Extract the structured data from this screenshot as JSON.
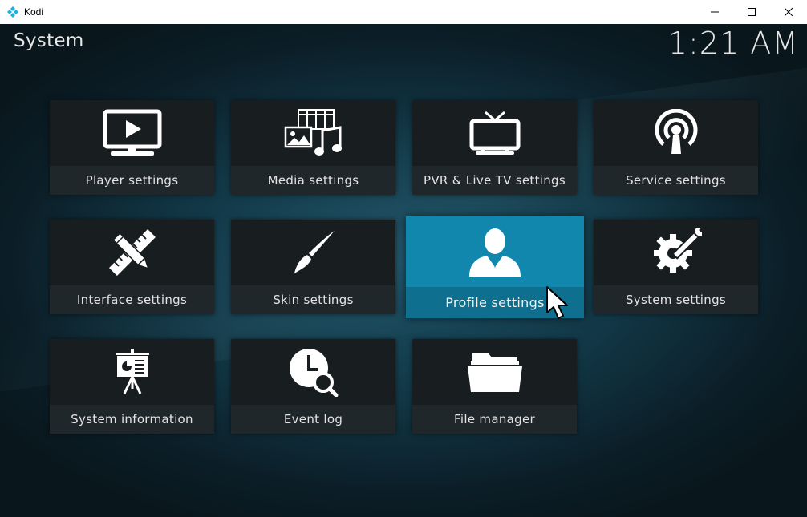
{
  "window": {
    "title": "Kodi",
    "controls": [
      "minimize",
      "maximize",
      "close"
    ]
  },
  "header": {
    "title": "System",
    "clock": "1:21 AM"
  },
  "tiles": [
    {
      "label": "Player settings",
      "icon": "play-screen-icon"
    },
    {
      "label": "Media settings",
      "icon": "media-icon"
    },
    {
      "label": "PVR & Live TV settings",
      "icon": "tv-icon"
    },
    {
      "label": "Service settings",
      "icon": "broadcast-icon"
    },
    {
      "label": "Interface settings",
      "icon": "pencil-ruler-icon"
    },
    {
      "label": "Skin settings",
      "icon": "paintbrush-icon"
    },
    {
      "label": "Profile settings",
      "icon": "user-icon",
      "focused": true
    },
    {
      "label": "System settings",
      "icon": "gear-wrench-icon"
    },
    {
      "label": "System information",
      "icon": "presentation-board-icon"
    },
    {
      "label": "Event log",
      "icon": "clock-search-icon"
    },
    {
      "label": "File manager",
      "icon": "folder-icon"
    }
  ],
  "colors": {
    "focus_accent": "#12a5d6",
    "tile_background": "#181d20"
  }
}
